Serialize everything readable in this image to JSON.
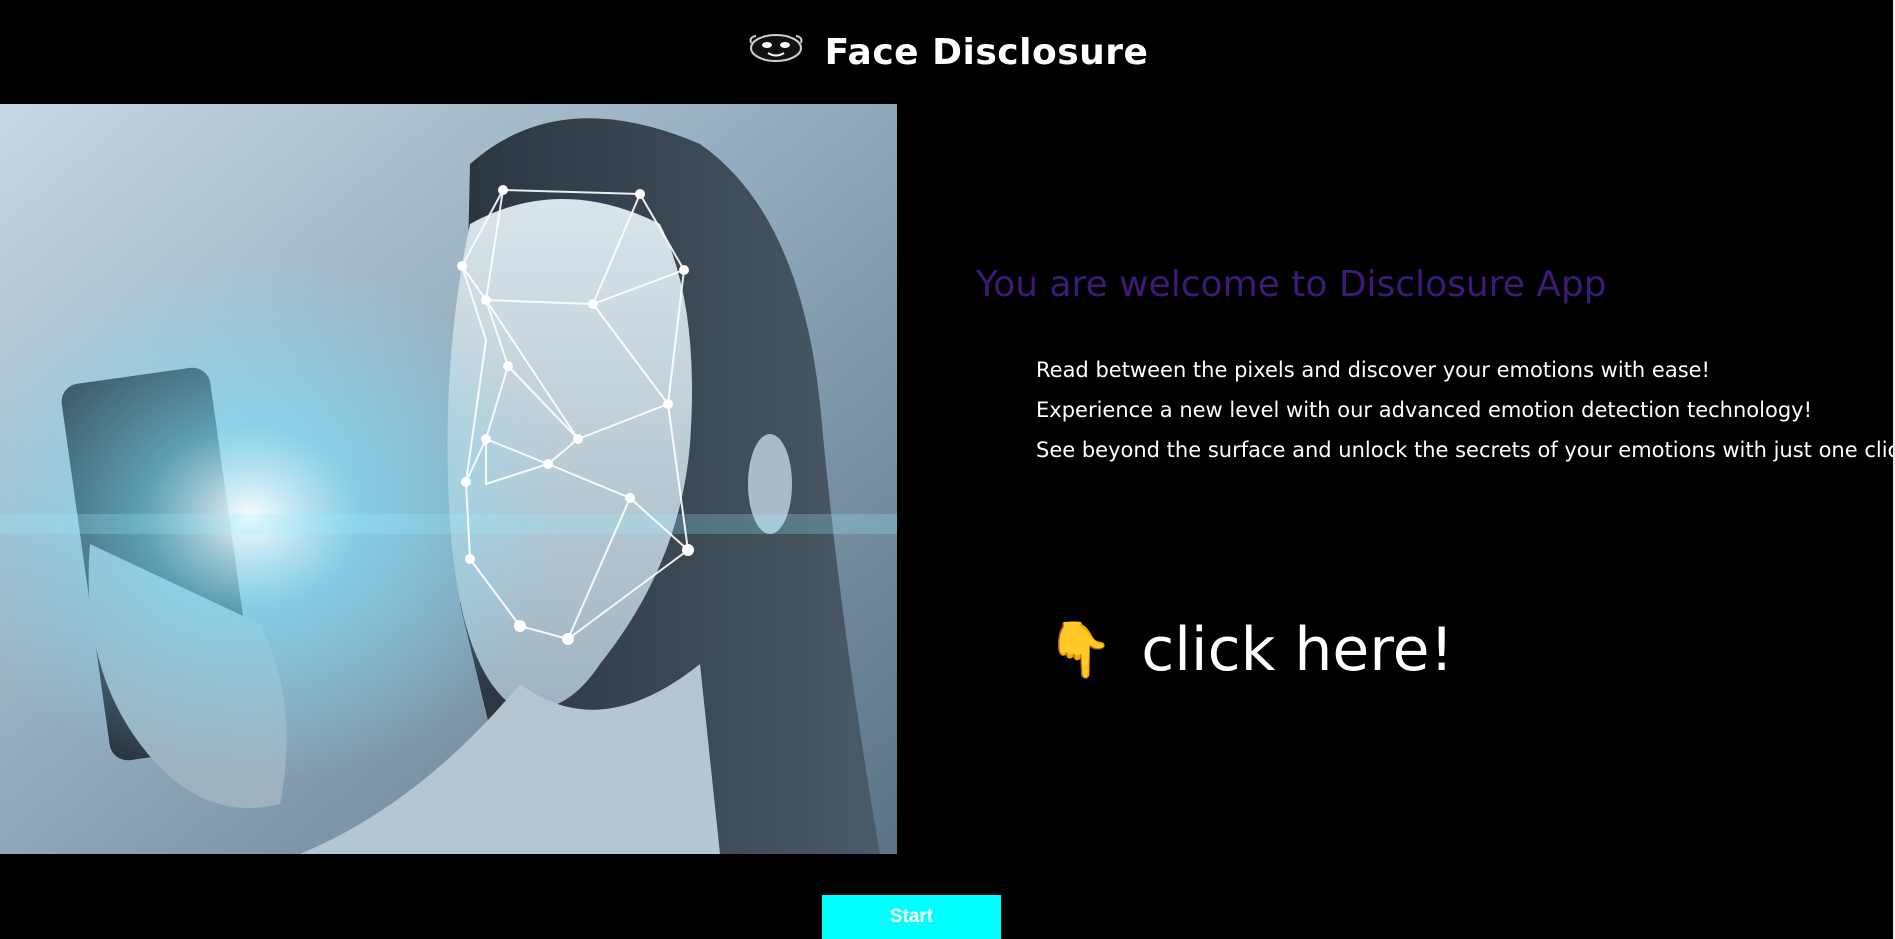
{
  "header": {
    "title": "Face Disclosure",
    "logo_icon": "face-mask-icon"
  },
  "hero": {
    "image_icon": "face-recognition-photo"
  },
  "main": {
    "welcome": "You are welcome to Disclosure App",
    "taglines": [
      "Read between the pixels and discover your emotions with ease!",
      "Experience a new level with our advanced emotion detection technology!",
      "See beyond the surface and unlock the secrets of your emotions with just one click!"
    ],
    "cta": {
      "icon": "👇",
      "label": "click here!"
    }
  },
  "footer": {
    "start_label": "Start"
  },
  "colors": {
    "background": "#000000",
    "welcome_text": "#3d1a78",
    "start_button": "#00ffff"
  }
}
